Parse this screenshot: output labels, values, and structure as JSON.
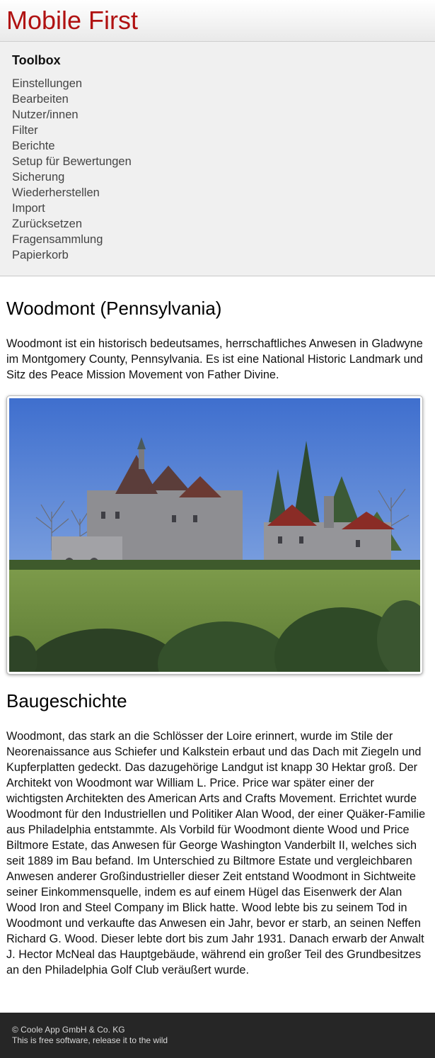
{
  "header": {
    "brand": "Mobile First"
  },
  "toolbox": {
    "title": "Toolbox",
    "items": [
      "Einstellungen",
      "Bearbeiten",
      "Nutzer/innen",
      "Filter",
      "Berichte",
      "Setup für Bewertungen",
      "Sicherung",
      "Wiederherstellen",
      "Import",
      "Zurücksetzen",
      "Fragensammlung",
      "Papierkorb"
    ]
  },
  "article": {
    "title": "Woodmont (Pennsylvania)",
    "intro": "Woodmont ist ein historisch bedeutsames, herrschaftliches Anwesen in Gladwyne im Montgomery County, Pennsylvania. Es ist eine National Historic Landmark und Sitz des Peace Mission Movement von Father Divine.",
    "section_title": "Baugeschichte",
    "section_text": "Woodmont, das stark an die Schlösser der Loire erinnert, wurde im Stile der Neorenaissance aus Schiefer und Kalkstein erbaut und das Dach mit Ziegeln und Kupferplatten gedeckt. Das dazugehörige Landgut ist knapp 30 Hektar groß. Der Architekt von Woodmont war William L. Price. Price war später einer der wichtigsten Architekten des American Arts and Crafts Movement. Errichtet wurde Woodmont für den Industriellen und Politiker Alan Wood, der einer Quäker-Familie aus Philadelphia entstammte. Als Vorbild für Woodmont diente Wood und Price Biltmore Estate, das Anwesen für George Washington Vanderbilt II, welches sich seit 1889 im Bau befand. Im Unterschied zu Biltmore Estate und vergleichbaren Anwesen anderer Großindustrieller dieser Zeit entstand Woodmont in Sichtweite seiner Einkommensquelle, indem es auf einem Hügel das Eisenwerk der Alan Wood Iron and Steel Company im Blick hatte. Wood lebte bis zu seinem Tod in Woodmont und verkaufte das Anwesen ein Jahr, bevor er starb, an seinen Neffen Richard G. Wood. Dieser lebte dort bis zum Jahr 1931. Danach erwarb der Anwalt J. Hector McNeal das Hauptgebäude, während ein großer Teil des Grundbesitzes an den Philadelphia Golf Club veräußert wurde."
  },
  "footer": {
    "copyright": "© Coole App GmbH & Co. KG",
    "tagline": "This is free software, release it to the wild"
  },
  "colors": {
    "brand": "#b01111",
    "footer_bg": "#262626",
    "toolbox_bg": "#f0f0f0"
  }
}
